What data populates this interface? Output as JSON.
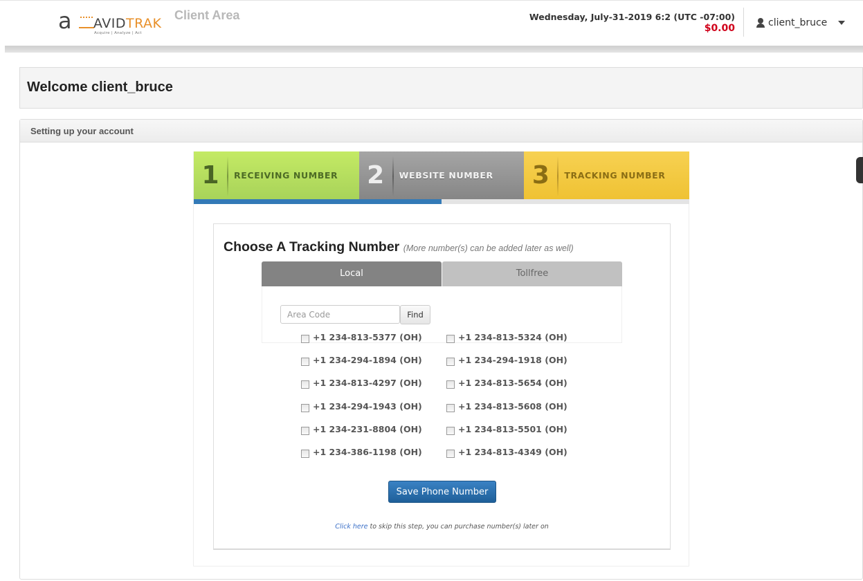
{
  "header": {
    "logo": {
      "mark": "a",
      "word_part1": "AVID",
      "word_part2": "TRAK",
      "tagline": "Acquire  |  Analyze  |  Act"
    },
    "section_title": "Client Area",
    "datetime": "Wednesday, July-31-2019 6:2 (UTC -07:00)",
    "balance": "$0.00",
    "username": "client_bruce"
  },
  "welcome": {
    "title": "Welcome client_bruce"
  },
  "setup_panel": {
    "title": "Setting up your account"
  },
  "wizard": {
    "steps": [
      {
        "number": "1",
        "label": "RECEIVING NUMBER"
      },
      {
        "number": "2",
        "label": "WEBSITE NUMBER"
      },
      {
        "number": "3",
        "label": "TRACKING NUMBER"
      }
    ],
    "progress_percent": 50
  },
  "tracking": {
    "title": "Choose A Tracking Number",
    "subtitle": "(More number(s) can be added later as well)",
    "tabs": [
      {
        "label": "Local",
        "active": true
      },
      {
        "label": "Tollfree",
        "active": false
      }
    ],
    "area_code_placeholder": "Area Code",
    "area_code_value": "",
    "find_label": "Find",
    "numbers": [
      [
        "+1 234-813-5377 (OH)",
        "+1 234-813-5324 (OH)"
      ],
      [
        "+1 234-294-1894 (OH)",
        "+1 234-294-1918 (OH)"
      ],
      [
        "+1 234-813-4297 (OH)",
        "+1 234-813-5654 (OH)"
      ],
      [
        "+1 234-294-1943 (OH)",
        "+1 234-813-5608 (OH)"
      ],
      [
        "+1 234-231-8804 (OH)",
        "+1 234-813-5501 (OH)"
      ],
      [
        "+1 234-386-1198 (OH)",
        "+1 234-813-4349 (OH)"
      ]
    ],
    "save_label": "Save Phone Number",
    "skip_link": "Click here",
    "skip_text": " to skip this step, you can purchase number(s) later on"
  }
}
